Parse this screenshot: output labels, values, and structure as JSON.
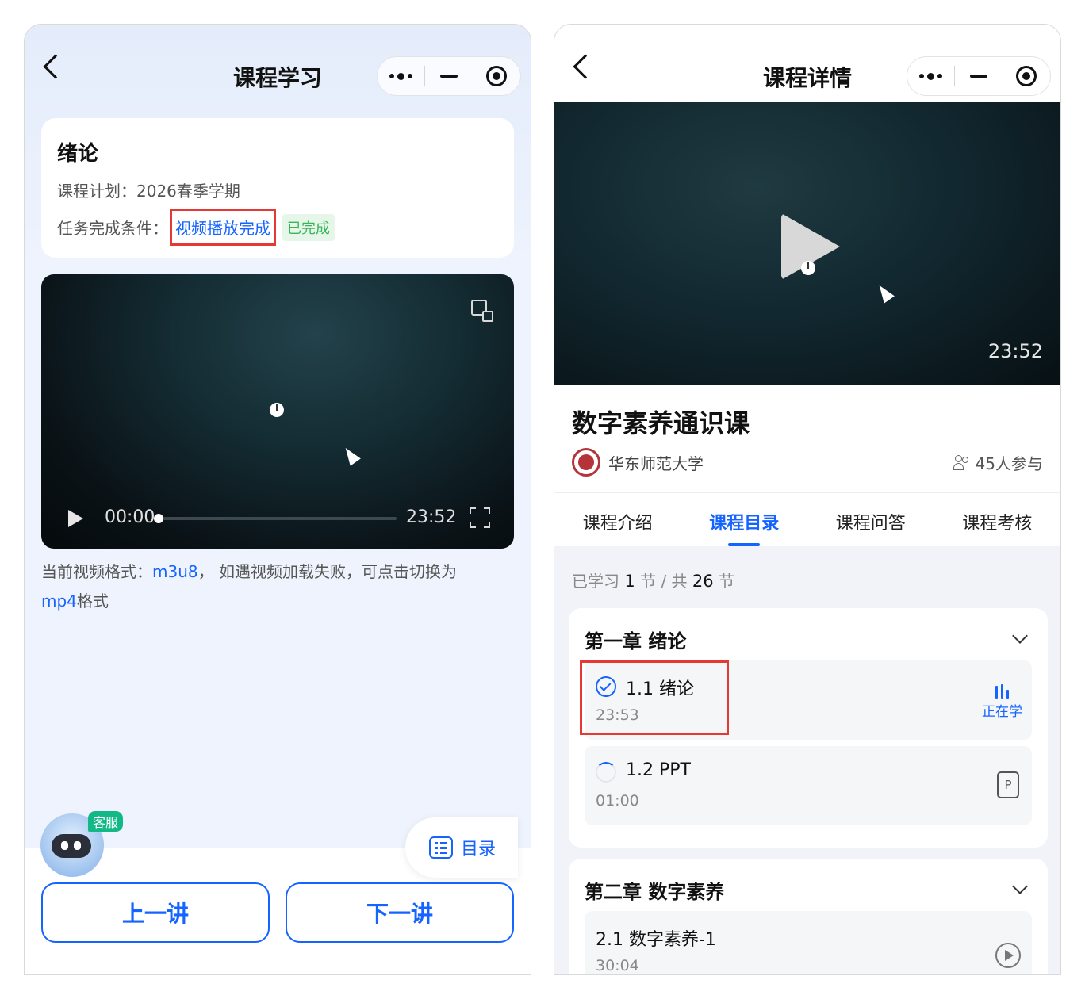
{
  "left": {
    "nav": {
      "title": "课程学习"
    },
    "info": {
      "heading": "绪论",
      "plan": "课程计划：2026春季学期",
      "condition_label": "任务完成条件：",
      "condition_value": "视频播放完成",
      "status": "已完成"
    },
    "player": {
      "current_time": "00:00",
      "total_time": "23:52",
      "progress": 0
    },
    "format_note": {
      "prefix": "当前视频格式：",
      "format": "m3u8",
      "middle": "， 如遇视频加载失败，可点击切换为",
      "switch_to": "mp4",
      "suffix": "格式"
    },
    "support_badge": "客服",
    "toc_label": "目录",
    "prev_label": "上一讲",
    "next_label": "下一讲"
  },
  "right": {
    "nav": {
      "title": "课程详情"
    },
    "video_duration": "23:52",
    "course_title": "数字素养通识课",
    "university": "华东师范大学",
    "participants": "45人参与",
    "tabs": [
      {
        "label": "课程介绍",
        "active": false
      },
      {
        "label": "课程目录",
        "active": true
      },
      {
        "label": "课程问答",
        "active": false
      },
      {
        "label": "课程考核",
        "active": false
      }
    ],
    "progress": {
      "learned_prefix": "已学习",
      "learned": "1",
      "learned_unit": "节 / 共",
      "total": "26",
      "total_unit": "节"
    },
    "chapters": [
      {
        "title": "第一章 绪论",
        "lessons": [
          {
            "name": "1.1 绪论",
            "time": "23:53",
            "status": "正在学"
          },
          {
            "name": "1.2 PPT",
            "time": "01:00",
            "type_icon": "P"
          }
        ]
      },
      {
        "title": "第二章 数字素养",
        "lessons": [
          {
            "name": "2.1 数字素养-1",
            "time": "30:04"
          }
        ]
      }
    ]
  },
  "colors": {
    "accent": "#1664ff",
    "highlight": "#e53935",
    "success": "#39b55a"
  }
}
